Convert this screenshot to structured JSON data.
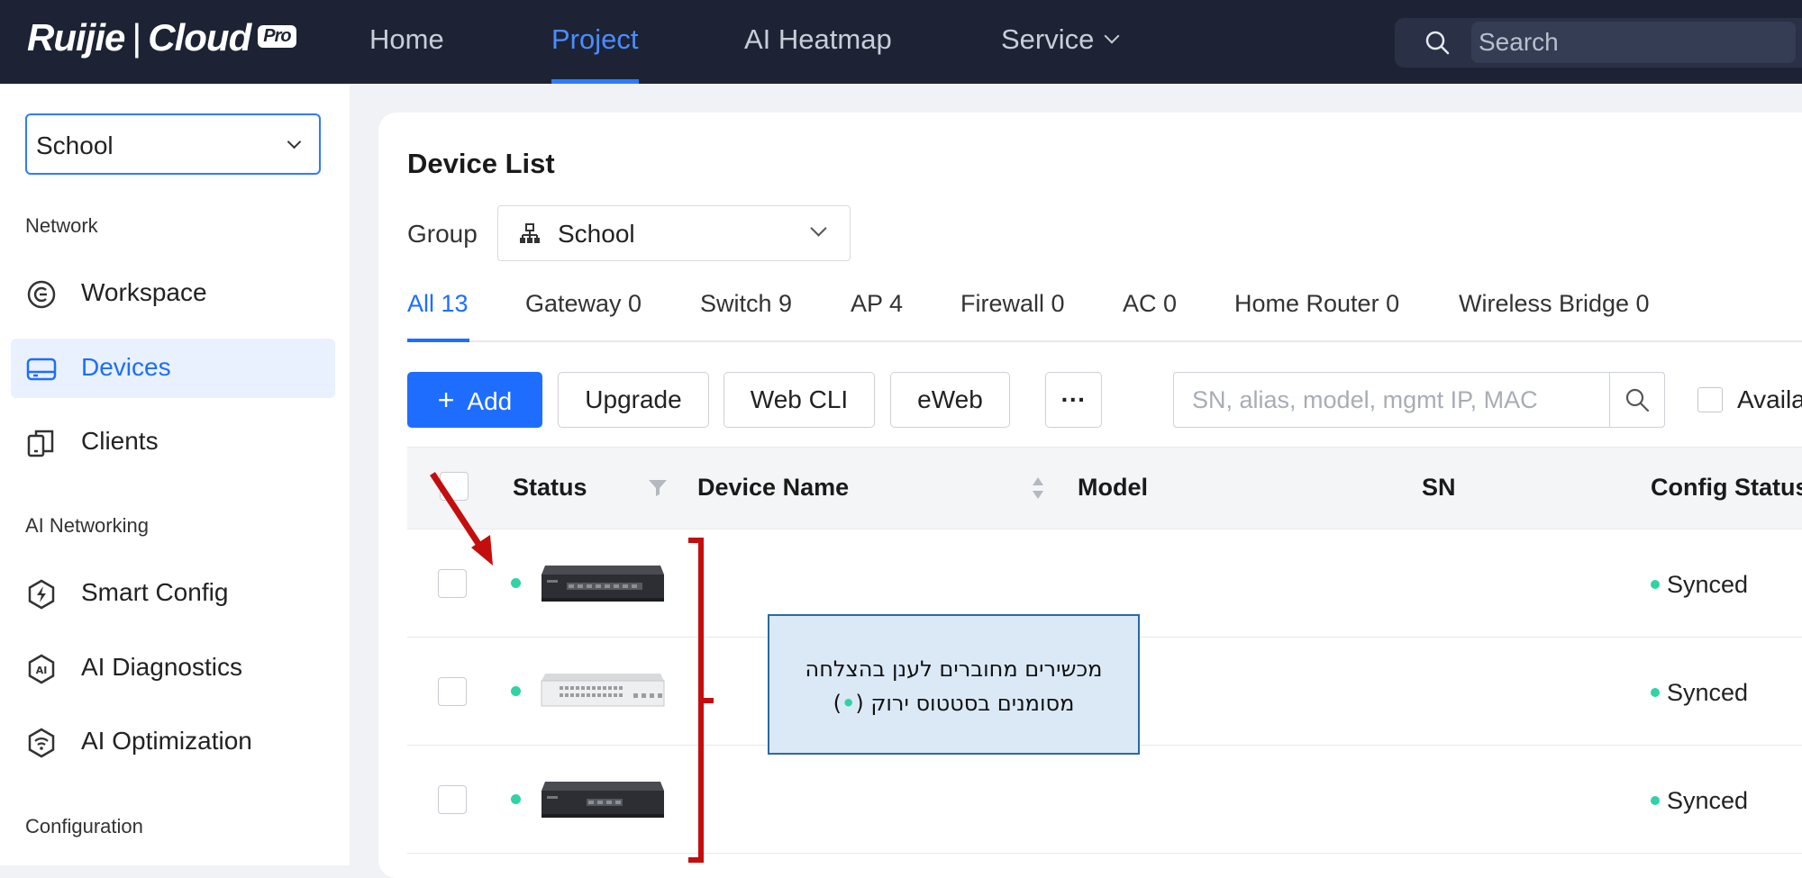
{
  "app": {
    "logo_brand": "Ruijie",
    "logo_product": "Cloud",
    "logo_badge": "Pro"
  },
  "nav": {
    "items": [
      {
        "label": "Home"
      },
      {
        "label": "Project"
      },
      {
        "label": "AI Heatmap"
      },
      {
        "label": "Service"
      }
    ],
    "active": "Project",
    "search_placeholder": "Search"
  },
  "sidebar": {
    "project": "School",
    "sections": {
      "network": "Network",
      "ai_networking": "AI Networking",
      "configuration": "Configuration"
    },
    "items": [
      {
        "label": "Workspace",
        "icon": "workspace-icon"
      },
      {
        "label": "Devices",
        "icon": "devices-icon"
      },
      {
        "label": "Clients",
        "icon": "clients-icon"
      },
      {
        "label": "Smart Config",
        "icon": "smart-config-icon"
      },
      {
        "label": "AI Diagnostics",
        "icon": "ai-diagnostics-icon"
      },
      {
        "label": "AI Optimization",
        "icon": "ai-optimization-icon"
      }
    ],
    "active": "Devices"
  },
  "main": {
    "title": "Device List",
    "group_label": "Group",
    "group_value": "School",
    "tabs": [
      {
        "label": "All 13"
      },
      {
        "label": "Gateway 0"
      },
      {
        "label": "Switch 9"
      },
      {
        "label": "AP 4"
      },
      {
        "label": "Firewall 0"
      },
      {
        "label": "AC 0"
      },
      {
        "label": "Home Router 0"
      },
      {
        "label": "Wireless Bridge 0"
      }
    ],
    "active_tab": "All 13",
    "toolbar": {
      "add": "Add",
      "upgrade": "Upgrade",
      "webcli": "Web CLI",
      "eweb": "eWeb",
      "more": "···",
      "search_placeholder": "SN, alias, model, mgmt IP, MAC",
      "available_label": "Availa"
    },
    "table": {
      "columns": [
        "Status",
        "Device Name",
        "Model",
        "SN",
        "Config Status"
      ],
      "rows": [
        {
          "status": "online",
          "device_type": "gateway-black",
          "config_status": "Synced"
        },
        {
          "status": "online",
          "device_type": "switch-white",
          "config_status": "Synced"
        },
        {
          "status": "online",
          "device_type": "gateway-black",
          "config_status": "Synced"
        }
      ]
    }
  },
  "annotation": {
    "line1": "מכשירים מחוברים לענן בהצלחה",
    "line2_text": "מסומנים בסטטוס ירוק",
    "line2_open": "(",
    "line2_dot": "•",
    "line2_close": ")"
  },
  "colors": {
    "accent": "#1e6dff",
    "topbar": "#1d2334",
    "online": "#2fd3a6",
    "annotation_red": "#c40d0d",
    "callout_bg": "#dbe9f6",
    "callout_border": "#2b6aa0"
  }
}
